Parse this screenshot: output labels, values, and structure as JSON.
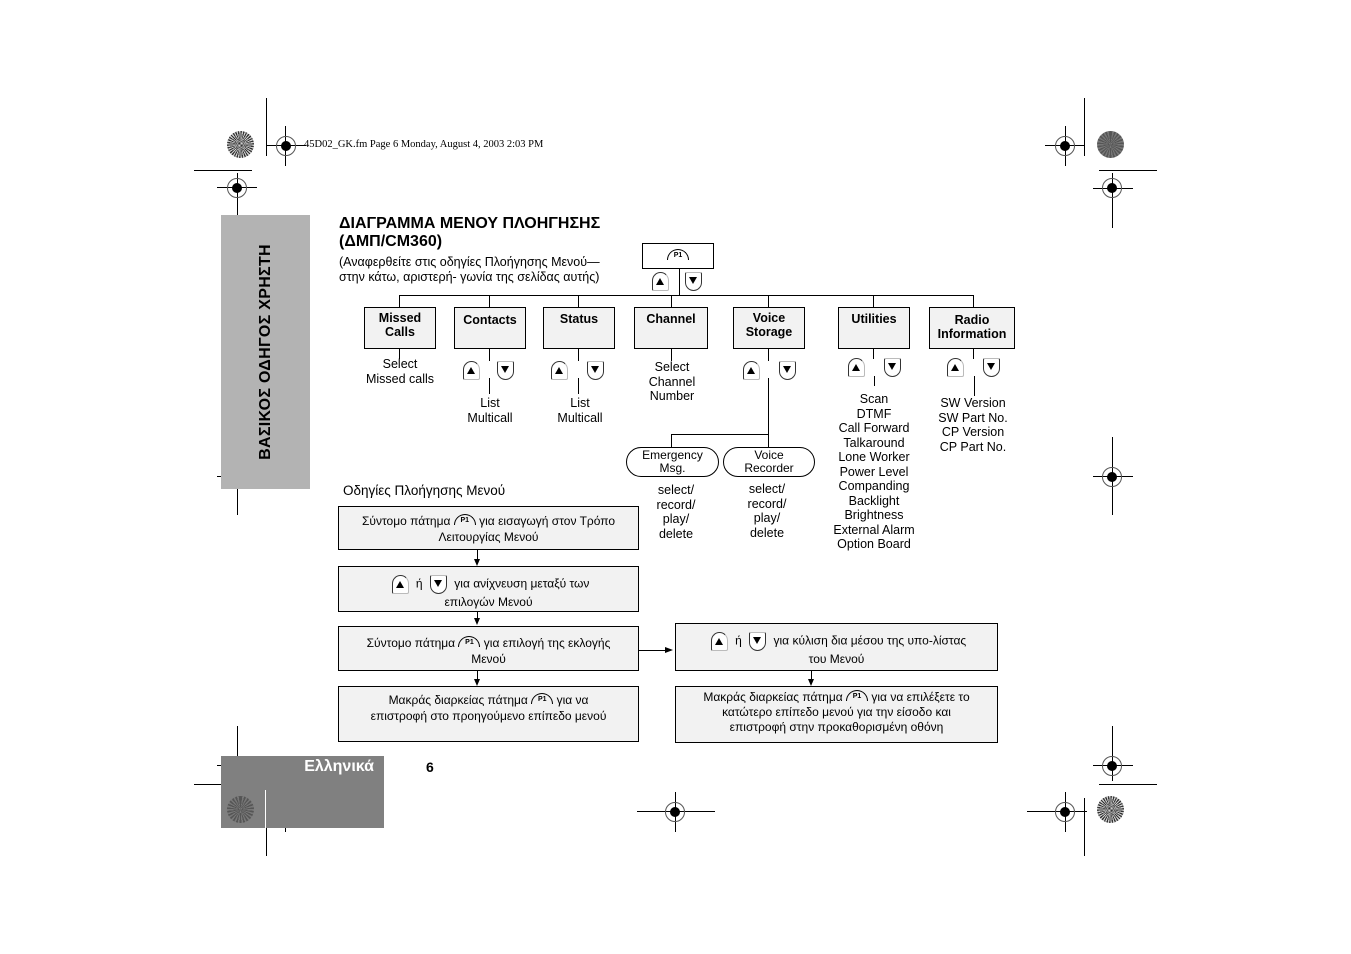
{
  "header": {
    "file_line": "45D02_GK.fm  Page 6  Monday, August 4, 2003  2:03 PM"
  },
  "side_tab": {
    "label": "ΒΑΣΙΚΟΣ ΟΔΗΓΟΣ ΧΡΗΣΤΗ"
  },
  "footer": {
    "language": "Ελληνικά",
    "page_number": "6"
  },
  "title": {
    "line1": "ΔΙΑΓΡΑΜΜΑ ΜΕΝΟΥ ΠΛΟΗΓΗΣΗΣ",
    "line2": "(ΔΜΠ/CM360)"
  },
  "subtitle": {
    "line1": "(Αναφερθείτε στις οδηγίες Πλοήγησης Μενού—",
    "line2": "στην κάτω,  αριστερή- γωνία της σελίδας αυτής)"
  },
  "icons": {
    "p1": "P1",
    "up": "up-arrow-button",
    "down": "down-arrow-button"
  },
  "menu": {
    "items": [
      {
        "line1": "Missed",
        "line2": "Calls",
        "sub": [
          "Select",
          "Missed calls"
        ]
      },
      {
        "line1": "Contacts",
        "line2": "",
        "sub": [
          "List",
          "Multicall"
        ]
      },
      {
        "line1": "Status",
        "line2": "",
        "sub": [
          "List",
          "Multicall"
        ]
      },
      {
        "line1": "Channel",
        "line2": "",
        "sub": [
          "Select",
          "Channel",
          "Number"
        ]
      },
      {
        "line1": "Voice",
        "line2": "Storage",
        "sub": []
      },
      {
        "line1": "Utilities",
        "line2": "",
        "sub": [
          "Scan",
          "DTMF",
          "Call Forward",
          "Talkaround",
          "Lone Worker",
          "Power Level",
          "Companding",
          "Backlight",
          "Brightness",
          "External Alarm",
          "Option Board"
        ]
      },
      {
        "line1": "Radio",
        "line2": "Information",
        "sub": [
          "SW Version",
          "SW Part No.",
          "CP Version",
          "CP Part No."
        ]
      }
    ],
    "voice_storage_children": [
      {
        "line1": "Emergency",
        "line2": "Msg.",
        "sub": [
          "select/",
          "record/",
          "play/",
          "delete"
        ]
      },
      {
        "line1": "Voice",
        "line2": "Recorder",
        "sub": [
          "select/",
          "record/",
          "play/",
          "delete"
        ]
      }
    ]
  },
  "instructions": {
    "heading": "Οδηγίες Πλοήγησης Μενού",
    "step1": {
      "before": "Σύντομο πάτημα",
      "after": "για εισαγωγή στον Τρόπο",
      "line2": "Λειτουργίας Μενού"
    },
    "step2": {
      "or": "ή",
      "after": "για ανίχνευση μεταξύ των",
      "line2": "επιλογών Μενού"
    },
    "step3": {
      "before": "Σύντομο πάτημα",
      "after": "για επιλογή της εκλογής",
      "line2": "Μενού"
    },
    "step4": {
      "before": "Μακράς διαρκείας πάτημα",
      "after": "για να",
      "line2": "επιστροφή στο προηγούμενο επίπεδο μενού"
    },
    "step5": {
      "or": "ή",
      "after": "για κύλιση δια μέσου της υπο-λίστας",
      "line2": "του Μενού"
    },
    "step6": {
      "before": "Μακράς διαρκείας πάτημα",
      "after": "για να επιλέξετε το",
      "line2": "κατώτερο επίπεδο μενού για την είσοδο και",
      "line3": "επιστροφή στην προκαθορισμένη οθόνη"
    }
  }
}
